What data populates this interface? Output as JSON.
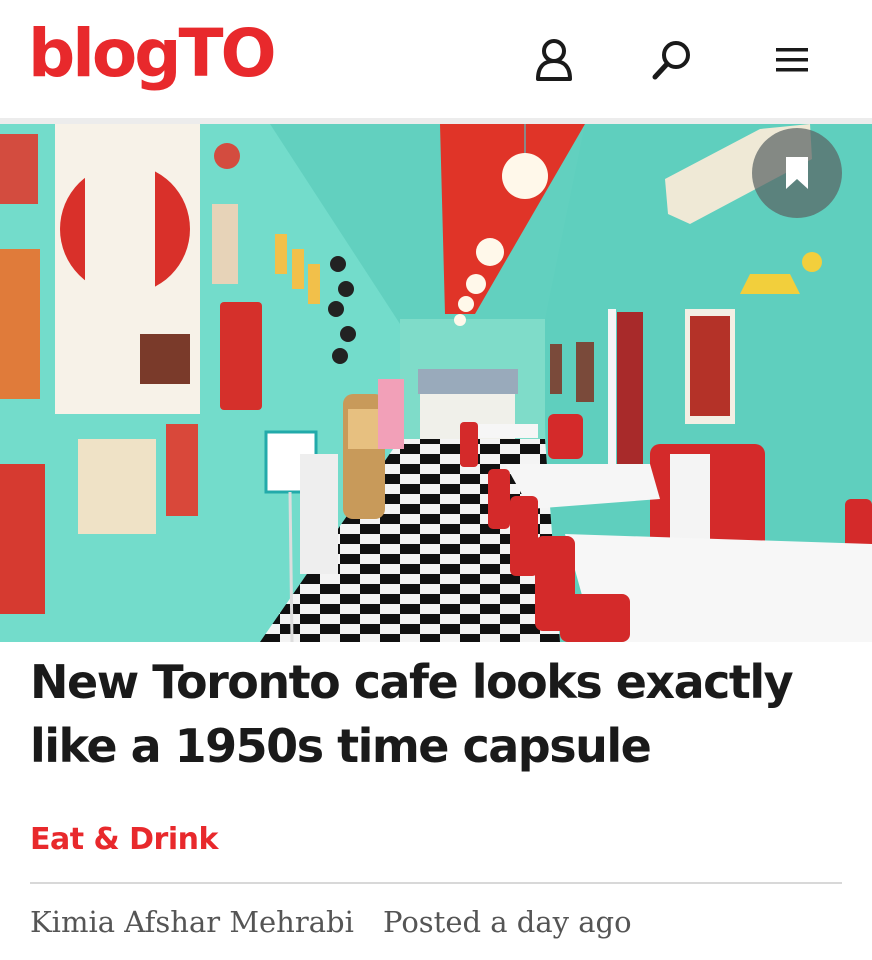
{
  "header": {
    "logo": "blogTO",
    "icons": {
      "account": "user-icon",
      "search": "search-icon",
      "menu": "hamburger-menu-icon"
    }
  },
  "hero": {
    "bookmark_icon": "bookmark-icon",
    "scene": "1950s diner interior"
  },
  "article": {
    "title": "New Toronto cafe looks exactly like a 1950s time capsule",
    "category": "Eat & Drink",
    "author": "Kimia Afshar Mehrabi",
    "posted": "Posted a day ago"
  },
  "colors": {
    "brand": "#e8292c",
    "text": "#1a1a1a",
    "meta": "#555555"
  }
}
